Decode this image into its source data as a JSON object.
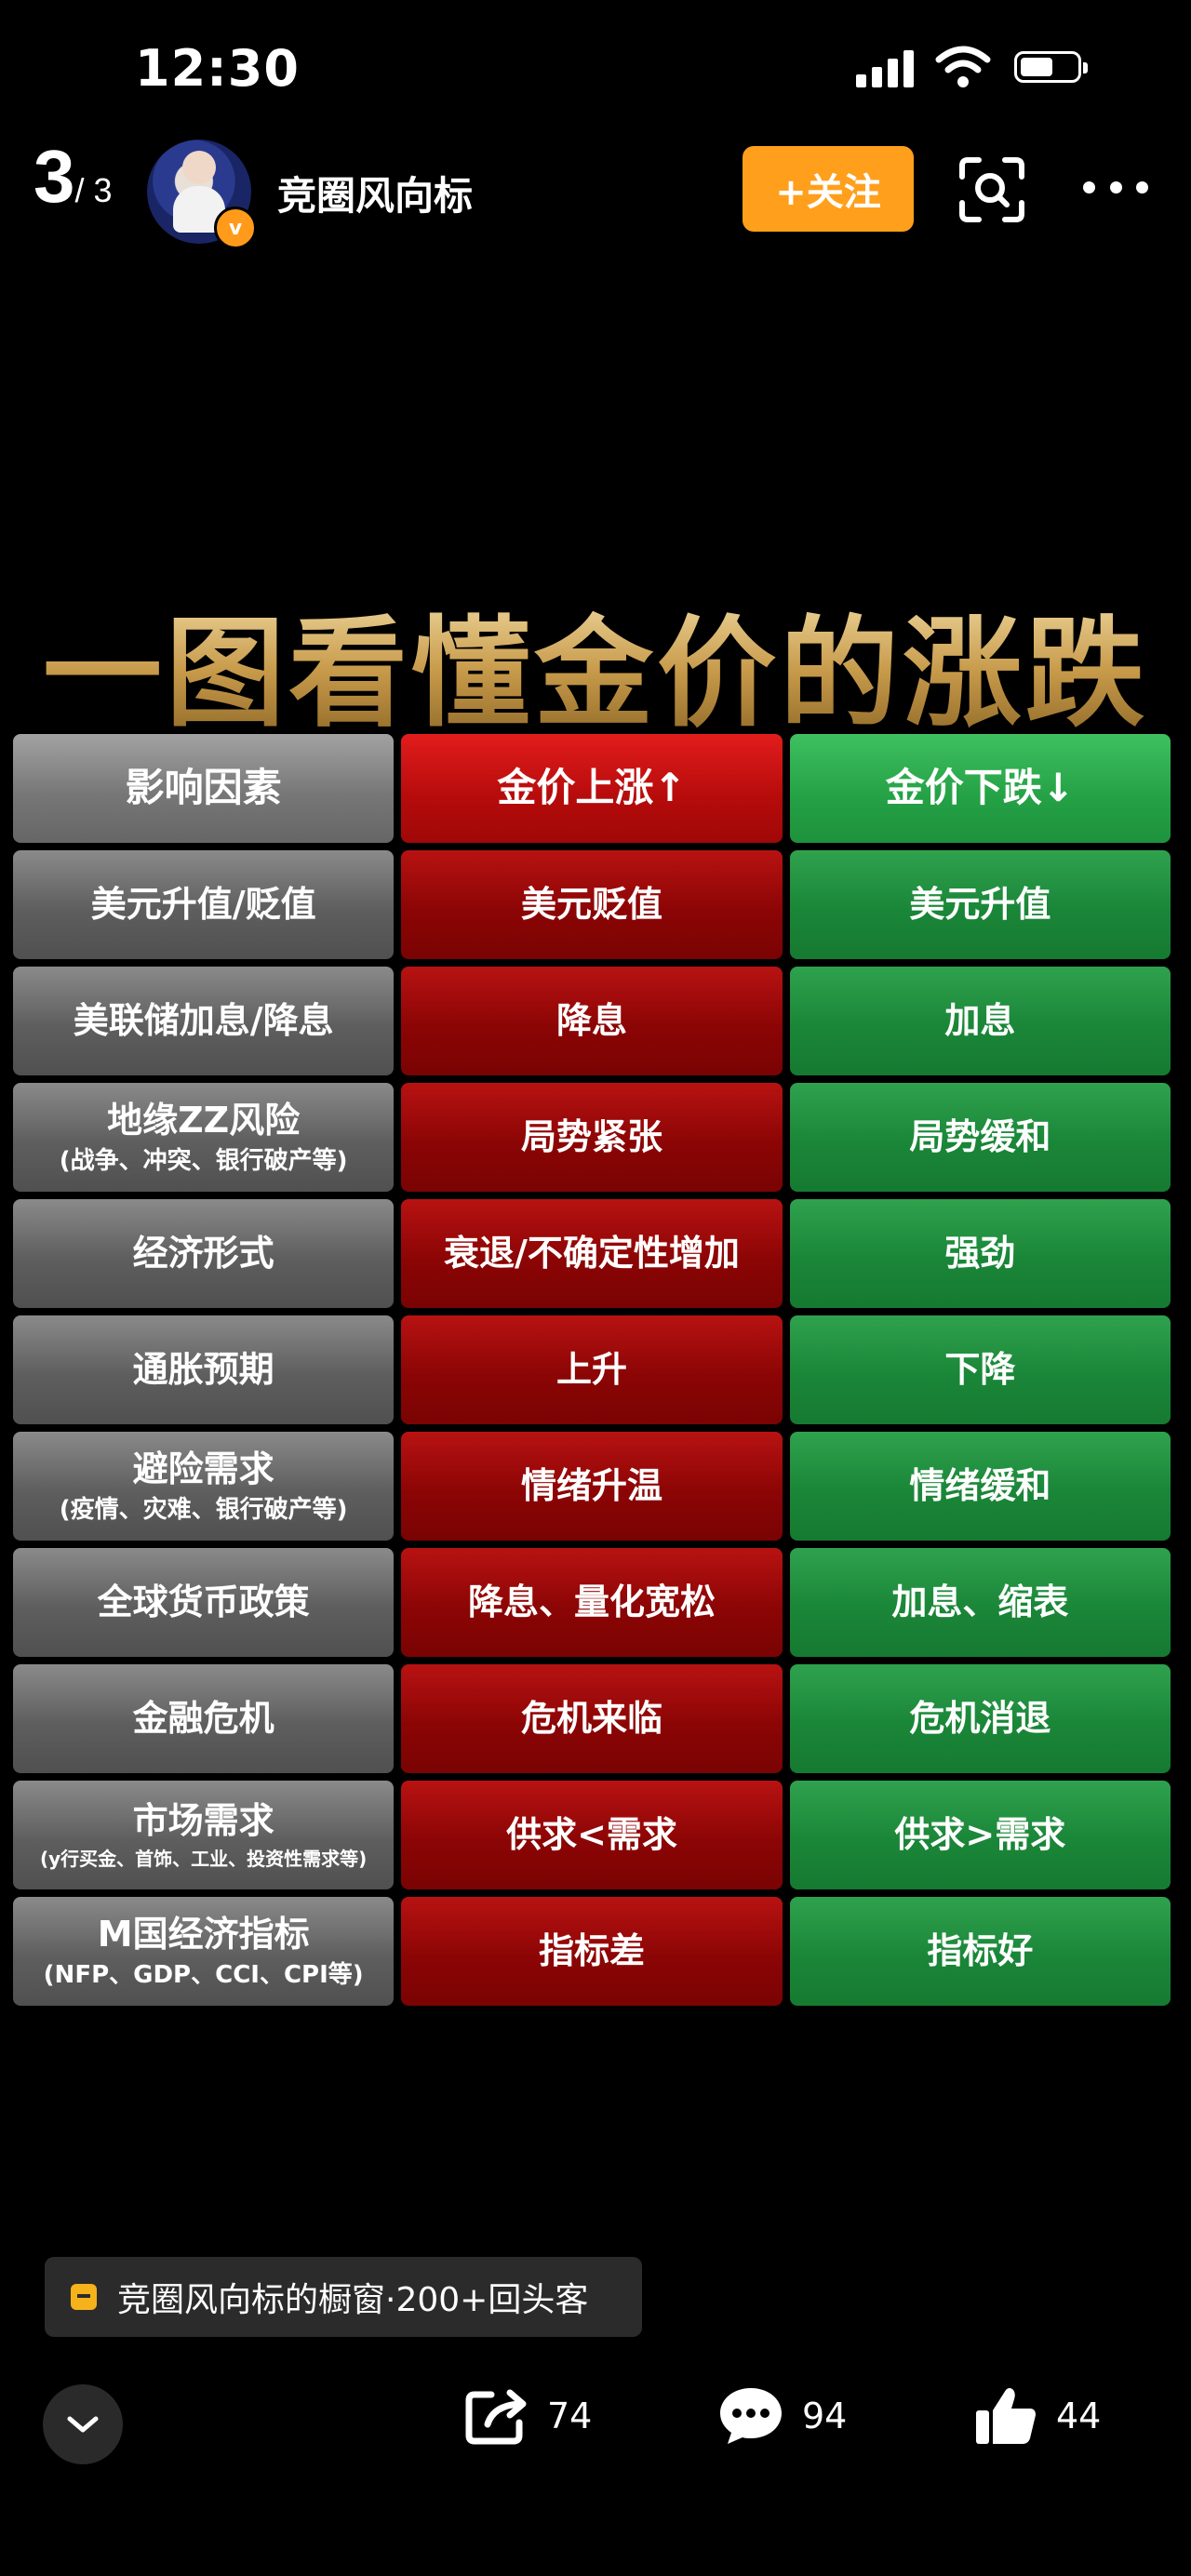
{
  "status_bar": {
    "time": "12:30"
  },
  "header": {
    "page_current": "3",
    "page_total": "/ 3",
    "username": "竞圈风向标",
    "verified_mark": "v",
    "follow_label": "+关注"
  },
  "infographic": {
    "title": "一图看懂金价的涨跌",
    "columns": [
      "影响因素",
      "金价上涨↑",
      "金价下跌↓"
    ],
    "rows": [
      {
        "factor": "美元升值/贬值",
        "factor_note": "",
        "up": "美元贬值",
        "down": "美元升值"
      },
      {
        "factor": "美联储加息/降息",
        "factor_note": "",
        "up": "降息",
        "down": "加息"
      },
      {
        "factor": "地缘ZZ风险",
        "factor_note": "(战争、冲突、银行破产等)",
        "up": "局势紧张",
        "down": "局势缓和"
      },
      {
        "factor": "经济形式",
        "factor_note": "",
        "up": "衰退/不确定性增加",
        "down": "强劲"
      },
      {
        "factor": "通胀预期",
        "factor_note": "",
        "up": "上升",
        "down": "下降"
      },
      {
        "factor": "避险需求",
        "factor_note": "(疫情、灾难、银行破产等)",
        "up": "情绪升温",
        "down": "情绪缓和"
      },
      {
        "factor": "全球货币政策",
        "factor_note": "",
        "up": "降息、量化宽松",
        "down": "加息、缩表"
      },
      {
        "factor": "金融危机",
        "factor_note": "",
        "up": "危机来临",
        "down": "危机消退"
      },
      {
        "factor": "市场需求",
        "factor_note": "(y行买金、首饰、工业、投资性需求等)",
        "up": "供求<需求",
        "down": "供求>需求"
      },
      {
        "factor": "M国经济指标",
        "factor_note": "(NFP、GDP、CCI、CPI等)",
        "up": "指标差",
        "down": "指标好"
      }
    ]
  },
  "shop_banner": {
    "text": "竞圈风向标的橱窗·200+回头客"
  },
  "actions": {
    "share_count": "74",
    "comment_count": "94",
    "like_count": "44"
  },
  "colors": {
    "accent_orange": "#ff9f1c",
    "rise_red": "#b81212",
    "fall_green": "#1a8638",
    "title_gold": "#d8b36a"
  },
  "icons": [
    "signal-icon",
    "wifi-icon",
    "battery-icon",
    "scan-icon",
    "more-icon",
    "shop-icon",
    "chevron-down-icon",
    "share-icon",
    "comment-icon",
    "thumbs-up-icon"
  ]
}
